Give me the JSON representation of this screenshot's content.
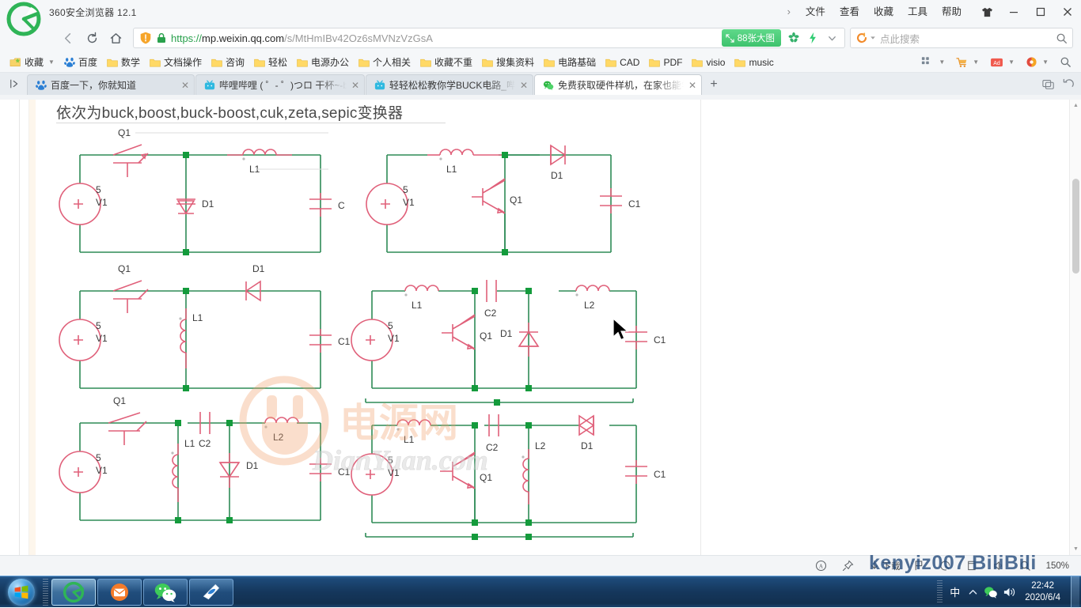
{
  "window": {
    "app_title": "360安全浏览器 12.1",
    "menus": [
      "文件",
      "查看",
      "收藏",
      "工具",
      "帮助"
    ],
    "more_chevron": "›",
    "controls": {
      "skin": "skin-icon",
      "minimize": "—",
      "maximize": "▢",
      "close": "✕"
    }
  },
  "nav": {
    "back": "back-arrow",
    "refresh": "refresh",
    "home": "home",
    "url": {
      "scheme": "https://",
      "host": "mp.weixin.qq.com",
      "path": "/s/MtHmIBv42Oz6sMVNzVzGsA"
    },
    "big_pic_badge": "88张大图",
    "search_placeholder": "点此搜索"
  },
  "bookmarks": {
    "favorites_label": "收藏",
    "items": [
      {
        "label": "百度",
        "icon": "baidu-icon"
      },
      {
        "label": "数学",
        "icon": "folder-icon"
      },
      {
        "label": "文档操作",
        "icon": "folder-icon"
      },
      {
        "label": "咨询",
        "icon": "folder-icon"
      },
      {
        "label": "轻松",
        "icon": "folder-icon"
      },
      {
        "label": "电源办公",
        "icon": "folder-icon"
      },
      {
        "label": "个人相关",
        "icon": "folder-icon"
      },
      {
        "label": "收藏不重",
        "icon": "folder-icon"
      },
      {
        "label": "搜集资料",
        "icon": "folder-icon"
      },
      {
        "label": "电路基础",
        "icon": "folder-icon"
      },
      {
        "label": "CAD",
        "icon": "folder-icon"
      },
      {
        "label": "PDF",
        "icon": "folder-icon"
      },
      {
        "label": "visio",
        "icon": "folder-icon"
      },
      {
        "label": "music",
        "icon": "folder-icon"
      }
    ]
  },
  "tabs": {
    "items": [
      {
        "label": "百度一下，你就知道",
        "icon": "baidu-icon",
        "active": false
      },
      {
        "label": "哔哩哔哩 ( ゜- ゜)つロ 干杯~-bil",
        "icon": "bilibili-icon",
        "active": false
      },
      {
        "label": "轻轻松松教你学BUCK电路_哔哩",
        "icon": "bilibili-icon",
        "active": false
      },
      {
        "label": "免费获取硬件样机，在家也能学",
        "icon": "wechat-icon",
        "active": true
      }
    ],
    "new_tab": "+",
    "close_glyph": "✕"
  },
  "page": {
    "caption": "依次为buck,boost,buck-boost,cuk,zeta,sepic变换器",
    "watermark_cn": "电源网",
    "watermark_en": "DianYuan.com",
    "source_value": "5",
    "source_name": "V1"
  },
  "circuits": [
    {
      "name": "buck",
      "labels": {
        "switch": "Q1",
        "diode": "D1",
        "inductor": "L1",
        "cap_out": "C",
        "src_val": "5",
        "src_name": "V1"
      }
    },
    {
      "name": "boost",
      "labels": {
        "inductor": "L1",
        "transistor": "Q1",
        "diode": "D1",
        "cap_out": "C1",
        "src_val": "5",
        "src_name": "V1"
      }
    },
    {
      "name": "buck-boost",
      "labels": {
        "switch": "Q1",
        "inductor": "L1",
        "diode": "D1",
        "cap_out": "C1",
        "src_val": "5",
        "src_name": "V1"
      }
    },
    {
      "name": "cuk",
      "labels": {
        "inductor1": "L1",
        "cap_coupling": "C2",
        "transistor": "Q1",
        "diode": "D1",
        "inductor2": "L2",
        "cap_out": "C1",
        "src_val": "5",
        "src_name": "V1"
      }
    },
    {
      "name": "zeta",
      "labels": {
        "switch": "Q1",
        "inductor1": "L1",
        "cap_coupling": "C2",
        "diode": "D1",
        "inductor2": "L2",
        "cap_out": "C1",
        "src_val": "5",
        "src_name": "V1"
      }
    },
    {
      "name": "sepic",
      "labels": {
        "inductor1": "L1",
        "transistor": "Q1",
        "cap_coupling": "C2",
        "inductor2": "L2",
        "diode": "D1",
        "cap_out": "C1",
        "src_val": "5",
        "src_name": "V1"
      }
    }
  ],
  "statusbar": {
    "items": [
      {
        "label": "",
        "icon": "ad-filter-icon"
      },
      {
        "label": "",
        "icon": "pin-icon"
      },
      {
        "label": "下载",
        "icon": "download-icon"
      },
      {
        "label": "",
        "icon": "flag-icon"
      },
      {
        "label": "",
        "icon": "speed-icon"
      },
      {
        "label": "",
        "icon": "window-icon"
      },
      {
        "label": "",
        "icon": "mute-icon"
      },
      {
        "label": "",
        "icon": "zoom-search-icon"
      },
      {
        "label": "150%",
        "icon": ""
      }
    ]
  },
  "taskbar": {
    "start": "start-orb",
    "buttons": [
      {
        "icon": "360-browser-icon",
        "active": true
      },
      {
        "icon": "foxmail-icon",
        "active": false
      },
      {
        "icon": "wechat-icon",
        "active": false
      },
      {
        "icon": "nero-icon",
        "active": false
      }
    ],
    "tray": {
      "ime": "中",
      "expand": "▲",
      "network": "network-icon",
      "volume": "volume-icon"
    },
    "clock_time": "22:42",
    "clock_date": "2020/6/4",
    "overlay_text": "kenyiz007 BiliBili"
  }
}
